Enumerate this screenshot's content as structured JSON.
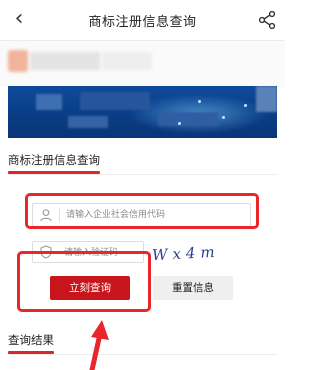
{
  "header": {
    "title": "商标注册信息查询",
    "back_icon": "chevron-left-icon",
    "share_icon": "share-icon"
  },
  "form": {
    "section_title": "商标注册信息查询",
    "credit_code_placeholder": "请输入企业社会信用代码",
    "captcha_placeholder": "请输入验证码",
    "captcha_text": "Wx4m",
    "query_label": "立刻查询",
    "reset_label": "重置信息"
  },
  "results": {
    "section_title": "查询结果"
  },
  "colors": {
    "accent_red": "#c8141b",
    "annotation_red": "#e8262b",
    "banner_blue": "#0e4a9a"
  }
}
